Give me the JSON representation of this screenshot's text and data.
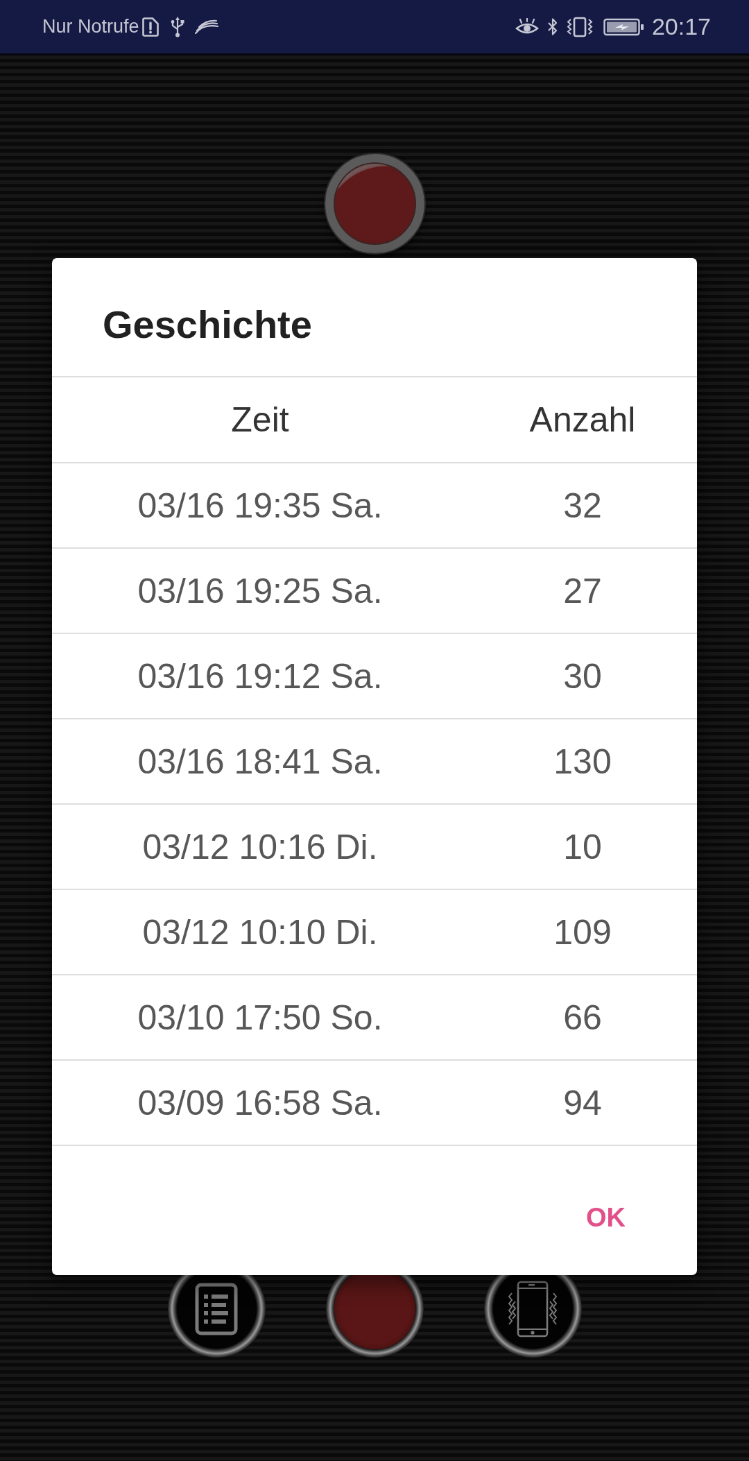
{
  "status_bar": {
    "notice": "Nur Notrufe",
    "time": "20:17"
  },
  "dialog": {
    "title": "Geschichte",
    "table": {
      "columns": [
        "Zeit",
        "Anzahl"
      ],
      "rows": [
        [
          "03/16 19:35 Sa.",
          "32"
        ],
        [
          "03/16 19:25 Sa.",
          "27"
        ],
        [
          "03/16 19:12 Sa.",
          "30"
        ],
        [
          "03/16 18:41 Sa.",
          "130"
        ],
        [
          "03/12 10:16 Di.",
          "10"
        ],
        [
          "03/12 10:10 Di.",
          "109"
        ],
        [
          "03/10 17:50 So.",
          "66"
        ],
        [
          "03/09 16:58 Sa.",
          "94"
        ]
      ]
    },
    "buttons": [
      "OK"
    ]
  }
}
